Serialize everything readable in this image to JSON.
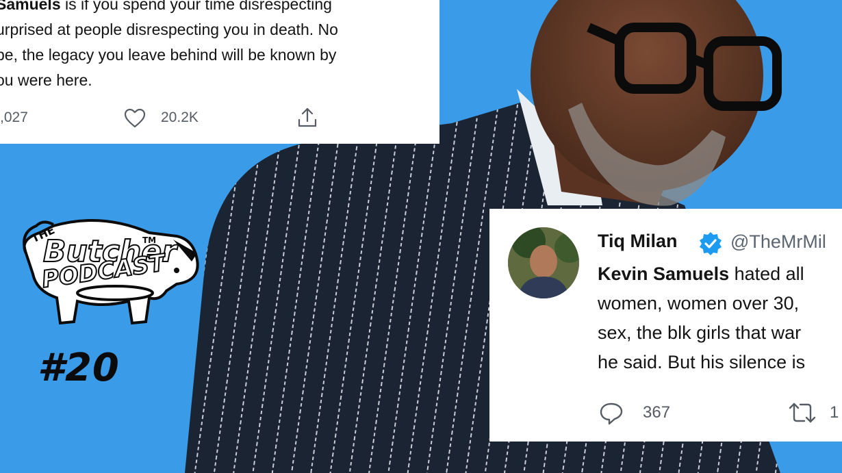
{
  "colors": {
    "background": "#3a9be8",
    "card": "#ffffff",
    "text": "#141414",
    "muted": "#555c63",
    "verified": "#1d9bf0",
    "suit": "#1b2433"
  },
  "tweet_top": {
    "line1_name": "Samuels",
    "line1_rest": " is if you spend your time disrespecting",
    "line2": "urprised at people disrespecting you in death. No",
    "line3": "be, the legacy you leave behind will be known by",
    "line4": "ou were here.",
    "count_left": ",027",
    "likes": "20.2K",
    "icons": [
      "heart-icon",
      "share-icon"
    ]
  },
  "tweet_br": {
    "name": "Tiq Milan",
    "handle": "@TheMrMil",
    "line1_name": "Kevin Samuels",
    "line1_rest": " hated all",
    "line2": "women, women over 30,",
    "line3": "sex, the blk girls that war",
    "line4": "he said. But his silence is",
    "replies": "367",
    "retweets": "1",
    "icons": [
      "reply-icon",
      "retweet-icon",
      "verified-badge-icon"
    ]
  },
  "logo": {
    "text_top": "THE",
    "text_main": "Butcher",
    "text_bottom": "PODCAST",
    "text_small": "TM",
    "episode": "#20"
  }
}
